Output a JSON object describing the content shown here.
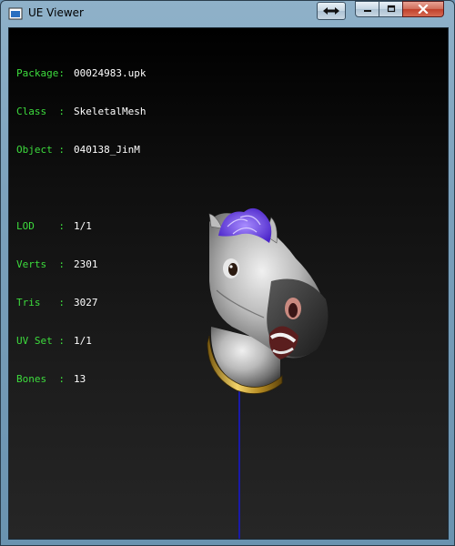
{
  "window": {
    "title": "UE Viewer",
    "controls": {
      "swap": "swap-icon",
      "minimize": "minimize-icon",
      "maximize": "maximize-icon",
      "close": "close-icon"
    }
  },
  "info": {
    "package": {
      "label": "Package:",
      "value": "00024983.upk"
    },
    "class": {
      "label": "Class  :",
      "value": "SkeletalMesh"
    },
    "object": {
      "label": "Object :",
      "value": "040138_JinM"
    },
    "lod": {
      "label": "LOD    :",
      "value": "1/1"
    },
    "verts": {
      "label": "Verts  :",
      "value": "2301"
    },
    "tris": {
      "label": "Tris   :",
      "value": "3027"
    },
    "uvset": {
      "label": "UV Set :",
      "value": "1/1"
    },
    "bones": {
      "label": "Bones  :",
      "value": "13"
    }
  },
  "colors": {
    "label": "#3ddc3d",
    "value": "#ffffff",
    "axis": "#1a1aa8",
    "mane": "#6a3cf0",
    "collar": "#c9a43a"
  }
}
